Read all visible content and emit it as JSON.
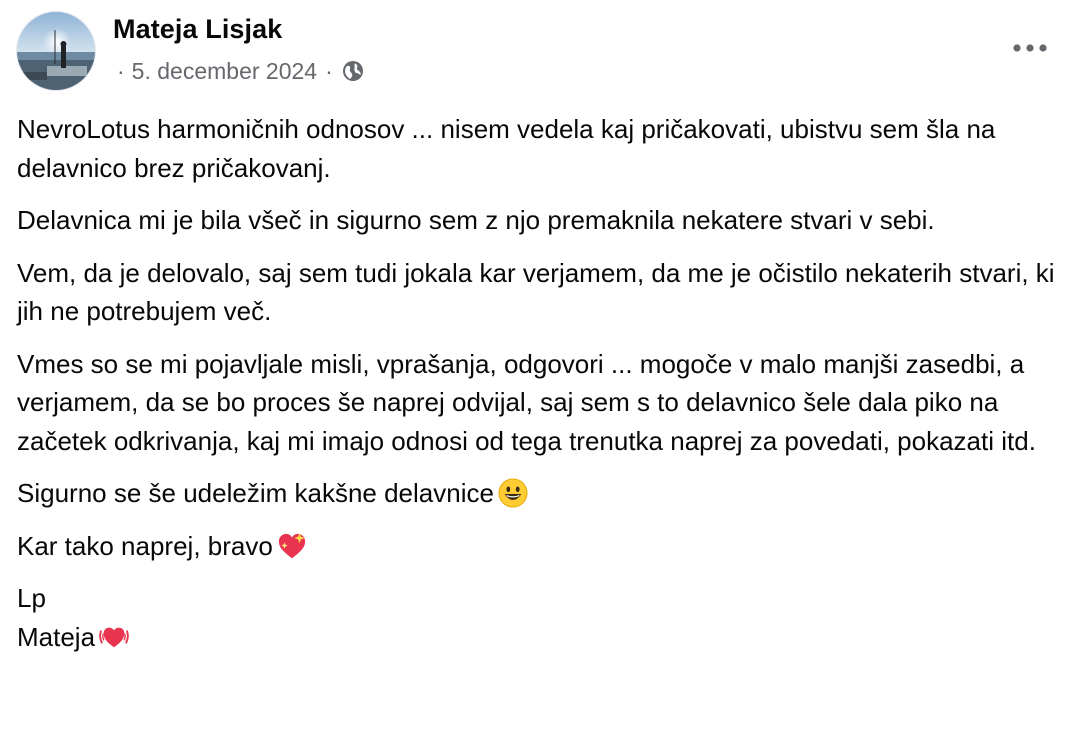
{
  "post": {
    "author": "Mateja Lisjak",
    "date_prefix": "·",
    "date": "5. december 2024",
    "date_suffix": "·",
    "audience_icon": "globe-icon",
    "more_icon": "more-horizontal-icon",
    "paragraphs": [
      "NevroLotus harmoničnih odnosov ... nisem vedela kaj pričakovati, ubistvu sem šla na delavnico brez pričakovanj.",
      "Delavnica mi je bila všeč in sigurno sem z njo premaknila nekatere stvari v sebi.",
      "Vem, da je delovalo, saj sem tudi jokala kar verjamem, da me je očistilo nekaterih stvari, ki jih ne potrebujem več.",
      "Vmes so se mi pojavljale misli, vprašanja, odgovori ... mogoče v malo manjši zasedbi, a verjamem, da se bo proces še naprej odvijal, saj sem s to delavnico šele dala piko na začetek odkrivanja, kaj mi imajo odnosi od tega trenutka naprej za povedati, pokazati itd.",
      "Sigurno se še udeležim kakšne delavnice",
      "Kar tako naprej, bravo",
      "Lp",
      "Mateja"
    ],
    "emojis": {
      "grinning": "grinning-face-emoji",
      "sparkling_heart": "sparkling-heart-emoji",
      "beating_heart": "beating-heart-emoji"
    }
  },
  "colors": {
    "text_primary": "#080809",
    "text_secondary": "#65686c",
    "emoji_yellow": "#ffcc33",
    "heart_red": "#e8344e"
  }
}
